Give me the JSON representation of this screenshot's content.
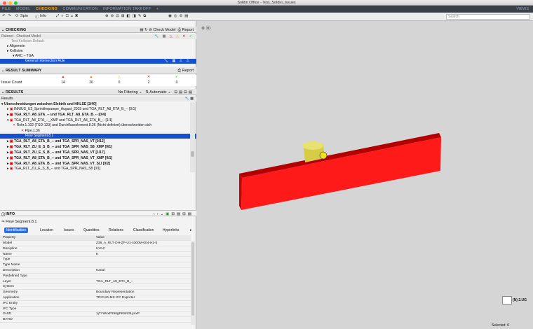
{
  "window": {
    "title": "Solibri Office - Test_Solibri_Issues"
  },
  "menu": {
    "items": [
      "FILE",
      "MODEL",
      "CHECKING",
      "COMMUNICATION",
      "INFORMATION TAKEOFF"
    ],
    "active": "CHECKING",
    "plus": "+",
    "views": "VIEWS"
  },
  "toolbar": {
    "spin": "Spin",
    "info": "Info",
    "search_placeholder": "Search"
  },
  "checking": {
    "title": "CHECKING",
    "check_model": "Check Model",
    "report": "Report",
    "ruleset_label": "Ruleset - Checked Model",
    "rows": [
      {
        "text": "Allgemein",
        "indent": 16
      },
      {
        "text": "Kollision",
        "indent": 16
      },
      {
        "text": "ARC – TGA",
        "indent": 24
      },
      {
        "text": "General Intersection Rule",
        "indent": 36,
        "selected": true
      }
    ]
  },
  "summary": {
    "title": "RESULT SUMMARY",
    "report": "Report",
    "issue_label": "Issue Count",
    "counts": [
      "14",
      "26",
      "0",
      "2",
      "0"
    ]
  },
  "results": {
    "title": "RESULTS",
    "filter": "No Filtering",
    "sort": "Automatic",
    "header": "Results",
    "rows": [
      {
        "text": "Überschneidungen zwischen Elektrik und HKLSE [2/40]",
        "indent": 2,
        "bold": true
      },
      {
        "text": "INNIUS_U2_Sprinklerpumpe_August_2019 und TGA_RLT_A8_ETA_B_-- [0/1]",
        "indent": 10
      },
      {
        "text": "TGA_RLT_A8_ETA_-- und TGA_RLT_A8_ETA_B_-- [0/4]",
        "indent": 10,
        "bold": true
      },
      {
        "text": "TGA_RLT_A8_ETA_--_XMP und TGA_RLT_A8_ETA_B_-- [1/1]",
        "indent": 10
      },
      {
        "text": "Rohr.1.102 (TSD-123) und Durchflusselement.8.26 (Nicht definiert) überschneiden sich",
        "indent": 18
      },
      {
        "text": "Pipe.1.36",
        "indent": 30
      },
      {
        "text": "Flow Segment.8.1",
        "indent": 36,
        "selected": true
      },
      {
        "text": "TGA_RLT_A8_ETA_B_-- und TGA_SPR_NAS_VT [0/12]",
        "indent": 10,
        "bold": true
      },
      {
        "text": "TGA_RLT_ZU_E_S_B_-- und TGA_SPR_NAS_S8_XMP [0/1]",
        "indent": 10,
        "bold": true
      },
      {
        "text": "TGA_RLT_ZU_E_S_B_-- und TGA_SPR_NAS_VT [1/17]",
        "indent": 10,
        "bold": true
      },
      {
        "text": "TGA_RLT_A8_ETA_B_-- und TGA_SPR_NAS_VT_XMP [0/1]",
        "indent": 10,
        "bold": true
      },
      {
        "text": "TGA_RLT_A8_ETA_B_-- und TGA_SPR_NAS_VT_SLI [0/2]",
        "indent": 10,
        "bold": true
      },
      {
        "text": "TGA_RLT_ZU_E_S_B_-- und TGA_SPR_NAS_S8 [0/1]",
        "indent": 10
      }
    ]
  },
  "info": {
    "title": "INFO",
    "object": "Flow Segment.8.1",
    "tabs": [
      "Identification",
      "Location",
      "Issues",
      "Quantities",
      "Relations",
      "Classification",
      "Hyperlinks"
    ],
    "active_tab": "Identification",
    "col_property": "Property",
    "col_value": "Value",
    "props": [
      [
        "Model",
        "Z36_A_RLT-OH-ZP-U1-4300M-004-H1-b"
      ],
      [
        "Discipline",
        "HVAC"
      ],
      [
        "Name",
        "K"
      ],
      [
        "Type",
        ""
      ],
      [
        "Type Name",
        ""
      ],
      [
        "Description",
        "Kanal"
      ],
      [
        "Predefined Type",
        ""
      ],
      [
        "Layer",
        "TGA_RLT_A8_ETA_B_--"
      ],
      [
        "System",
        ""
      ],
      [
        "Geometry",
        "Boundary Representation"
      ],
      [
        "Application",
        "TRICAD-MS IFC Exporter"
      ],
      [
        "IFC Entity",
        ""
      ],
      [
        "IFC Type",
        ""
      ],
      [
        "GUID",
        "1j7YWxxPz66gPKWd3LyuxP"
      ],
      [
        "BATID",
        ""
      ]
    ]
  },
  "view3d": {
    "title": "3D",
    "selected": "Selected: 0",
    "nav_label": "(N) 2.UG"
  },
  "colors": {
    "accent": "#f2a21a",
    "selection": "#1550d0",
    "duct": "#ff1a1a",
    "pipe": "#c8c040"
  }
}
